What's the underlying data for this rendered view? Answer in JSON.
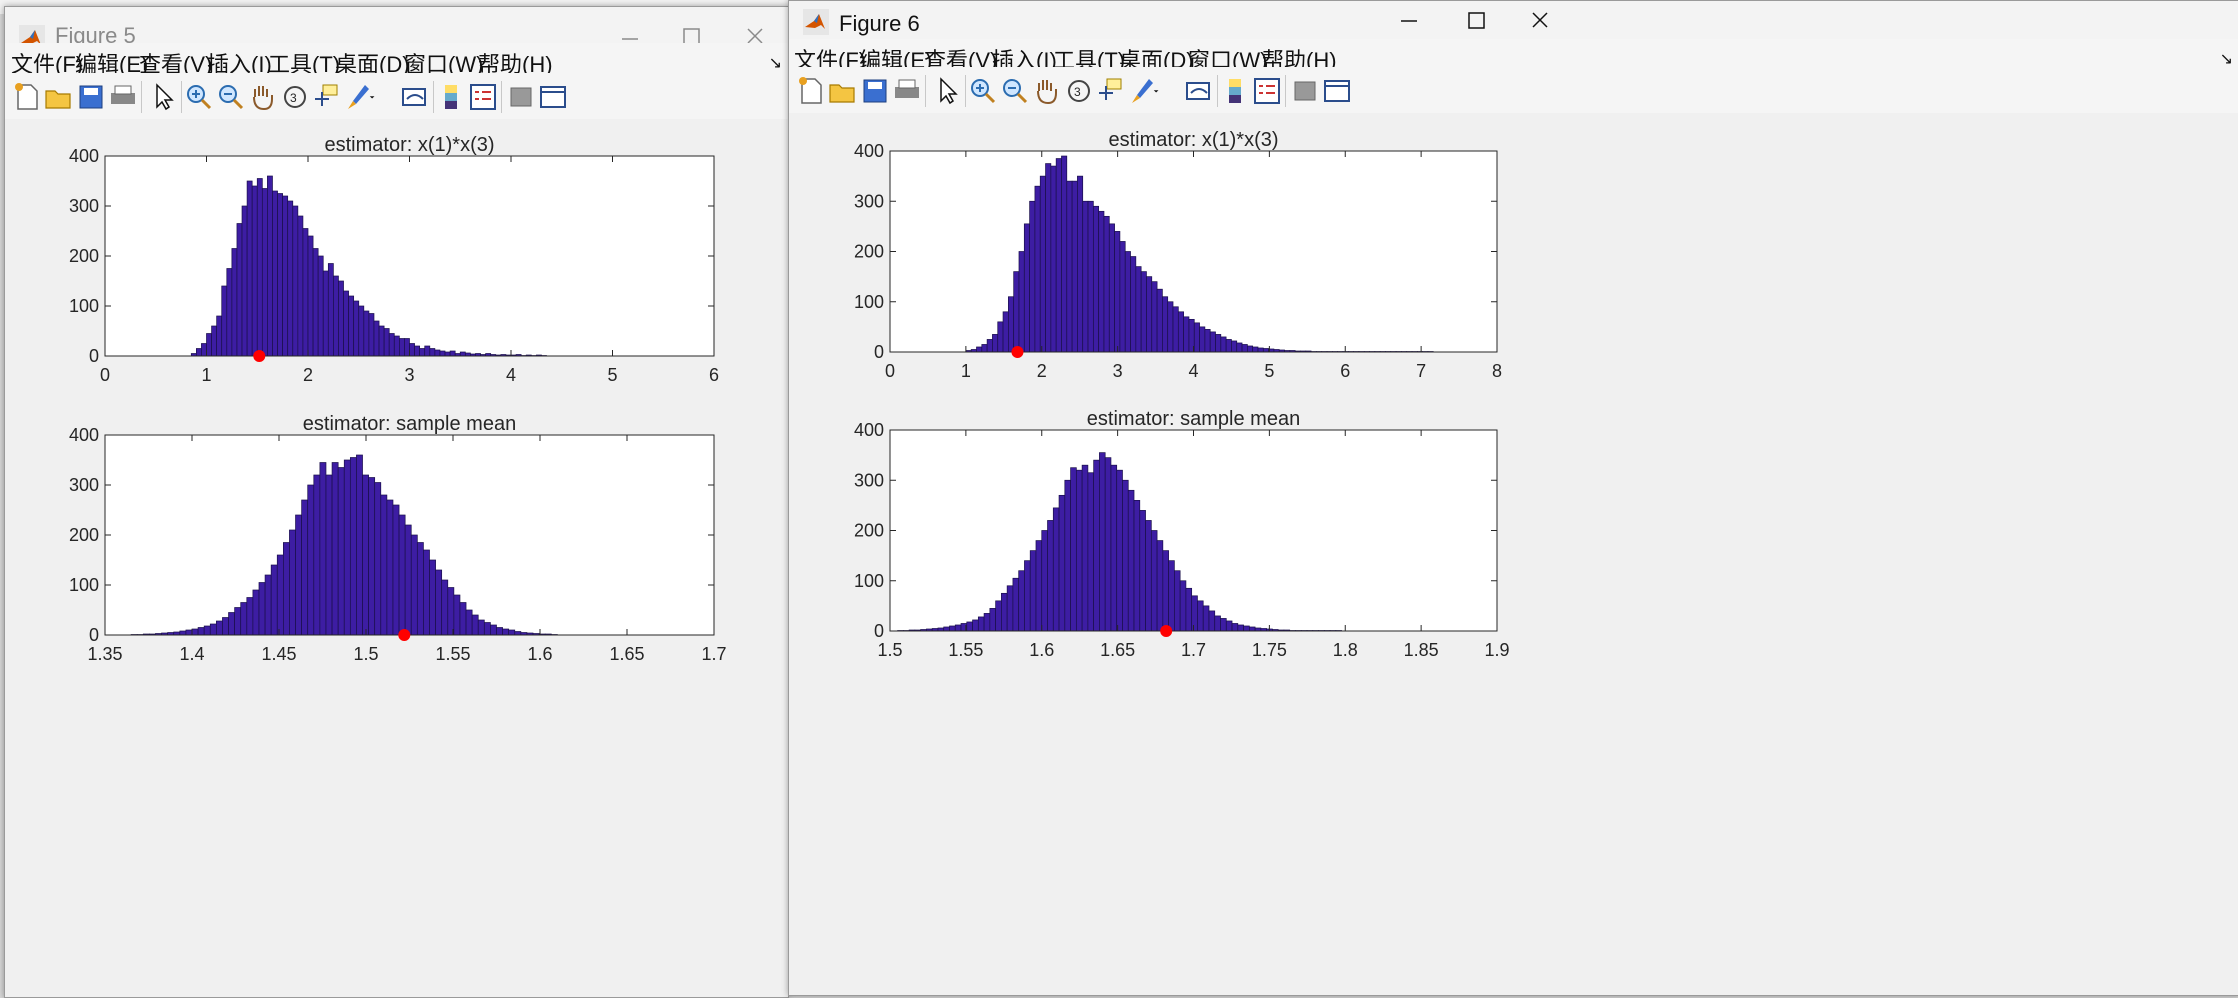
{
  "windows": [
    {
      "title": "Figure 5",
      "menu": [
        "文件(F)",
        "编辑(E)",
        "查看(V)",
        "插入(I)",
        "工具(T)",
        "桌面(D)",
        "窗口(W)",
        "帮助(H)"
      ]
    },
    {
      "title": "Figure 6",
      "menu": [
        "文件(F)",
        "编辑(E)",
        "查看(V)",
        "插入(I)",
        "工具(T)",
        "桌面(D)",
        "窗口(W)",
        "帮助(H)"
      ]
    }
  ],
  "toolbar_icons": [
    "new-figure-icon",
    "open-file-icon",
    "save-icon",
    "print-icon",
    "pointer-icon",
    "zoom-in-icon",
    "zoom-out-icon",
    "pan-hand-icon",
    "rotate-3d-icon",
    "data-cursor-icon",
    "brush-icon",
    "brush-dropdown-icon",
    "link-plot-icon",
    "colorbar-icon",
    "legend-icon",
    "hide-plot-tools-icon",
    "show-plot-tools-icon"
  ],
  "colors": {
    "bar_fill": "#3d1da3",
    "bar_edge": "#1a0f4a",
    "true_value_marker": "#ff0000",
    "axes_bg": "#ffffff",
    "figure_bg": "#f0f0f0"
  },
  "chart_data": [
    {
      "figure": "Figure 5",
      "type": "bar",
      "title": "estimator: x(1)*x(3)",
      "xlabel": "",
      "ylabel": "",
      "xlim": [
        0,
        6
      ],
      "ylim": [
        0,
        400
      ],
      "xticks": [
        "0",
        "1",
        "2",
        "3",
        "4",
        "5",
        "6"
      ],
      "yticks": [
        "0",
        "100",
        "200",
        "300",
        "400"
      ],
      "bin_start": 0.85,
      "bin_width": 0.05,
      "values": [
        5,
        15,
        25,
        45,
        60,
        80,
        140,
        175,
        215,
        265,
        300,
        350,
        340,
        355,
        335,
        360,
        330,
        325,
        320,
        310,
        300,
        280,
        255,
        240,
        215,
        200,
        170,
        185,
        160,
        150,
        130,
        120,
        110,
        100,
        90,
        85,
        70,
        60,
        55,
        45,
        40,
        35,
        35,
        25,
        20,
        15,
        20,
        15,
        12,
        10,
        8,
        10,
        5,
        8,
        6,
        4,
        5,
        3,
        5,
        3,
        2,
        3,
        2,
        2,
        3,
        1,
        2,
        1,
        2,
        1
      ],
      "marker": {
        "x": 1.52,
        "y": 0
      }
    },
    {
      "figure": "Figure 5",
      "type": "bar",
      "title": "estimator: sample mean",
      "xlabel": "",
      "ylabel": "",
      "xlim": [
        1.35,
        1.7
      ],
      "ylim": [
        0,
        400
      ],
      "xticks": [
        "1.35",
        "1.4",
        "1.45",
        "1.5",
        "1.55",
        "1.6",
        "1.65",
        "1.7"
      ],
      "yticks": [
        "0",
        "100",
        "200",
        "300",
        "400"
      ],
      "bin_start": 1.365,
      "bin_width": 0.0035,
      "values": [
        1,
        1,
        2,
        2,
        3,
        4,
        5,
        6,
        8,
        10,
        12,
        15,
        18,
        22,
        28,
        35,
        45,
        55,
        65,
        75,
        90,
        105,
        120,
        140,
        160,
        185,
        210,
        240,
        270,
        300,
        320,
        345,
        320,
        345,
        335,
        350,
        355,
        360,
        320,
        315,
        305,
        280,
        270,
        260,
        240,
        220,
        200,
        185,
        170,
        150,
        130,
        110,
        95,
        80,
        65,
        50,
        40,
        30,
        25,
        20,
        15,
        12,
        10,
        7,
        5,
        4,
        3,
        2,
        2,
        1
      ],
      "marker": {
        "x": 1.522,
        "y": 0
      }
    },
    {
      "figure": "Figure 6",
      "type": "bar",
      "title": "estimator: x(1)*x(3)",
      "xlabel": "",
      "ylabel": "",
      "xlim": [
        0,
        8
      ],
      "ylim": [
        0,
        400
      ],
      "xticks": [
        "0",
        "1",
        "2",
        "3",
        "4",
        "5",
        "6",
        "7",
        "8"
      ],
      "yticks": [
        "0",
        "100",
        "200",
        "300",
        "400"
      ],
      "bin_start": 1.0,
      "bin_width": 0.07,
      "values": [
        3,
        5,
        10,
        15,
        25,
        35,
        60,
        80,
        110,
        160,
        200,
        255,
        300,
        330,
        350,
        375,
        370,
        385,
        390,
        340,
        340,
        350,
        300,
        300,
        290,
        280,
        270,
        255,
        240,
        220,
        200,
        190,
        170,
        160,
        150,
        140,
        125,
        110,
        100,
        90,
        80,
        70,
        65,
        58,
        50,
        45,
        40,
        35,
        30,
        25,
        22,
        18,
        15,
        12,
        10,
        8,
        7,
        6,
        5,
        4,
        3,
        3,
        2,
        2,
        2,
        1,
        1,
        1,
        1,
        1,
        1,
        1,
        1,
        1,
        1,
        1,
        1,
        1,
        1,
        1,
        1,
        1,
        1,
        1,
        1,
        1,
        1,
        1
      ],
      "marker": {
        "x": 1.68,
        "y": 0
      }
    },
    {
      "figure": "Figure 6",
      "type": "bar",
      "title": "estimator: sample mean",
      "xlabel": "",
      "ylabel": "",
      "xlim": [
        1.5,
        1.9
      ],
      "ylim": [
        0,
        400
      ],
      "xticks": [
        "1.5",
        "1.55",
        "1.6",
        "1.65",
        "1.7",
        "1.75",
        "1.8",
        "1.85",
        "1.9"
      ],
      "yticks": [
        "0",
        "100",
        "200",
        "300",
        "400"
      ],
      "bin_start": 1.505,
      "bin_width": 0.0038,
      "values": [
        1,
        1,
        2,
        2,
        3,
        4,
        5,
        6,
        8,
        10,
        12,
        15,
        18,
        22,
        28,
        35,
        45,
        60,
        75,
        90,
        105,
        120,
        140,
        160,
        180,
        200,
        220,
        245,
        270,
        300,
        325,
        320,
        330,
        315,
        340,
        355,
        345,
        330,
        320,
        300,
        280,
        260,
        240,
        220,
        200,
        180,
        160,
        140,
        120,
        100,
        85,
        70,
        60,
        50,
        40,
        30,
        25,
        20,
        15,
        12,
        10,
        8,
        6,
        5,
        4,
        3,
        2,
        2,
        1,
        1,
        1,
        1,
        1,
        1,
        1,
        1,
        1
      ],
      "marker": {
        "x": 1.682,
        "y": 0
      }
    }
  ]
}
